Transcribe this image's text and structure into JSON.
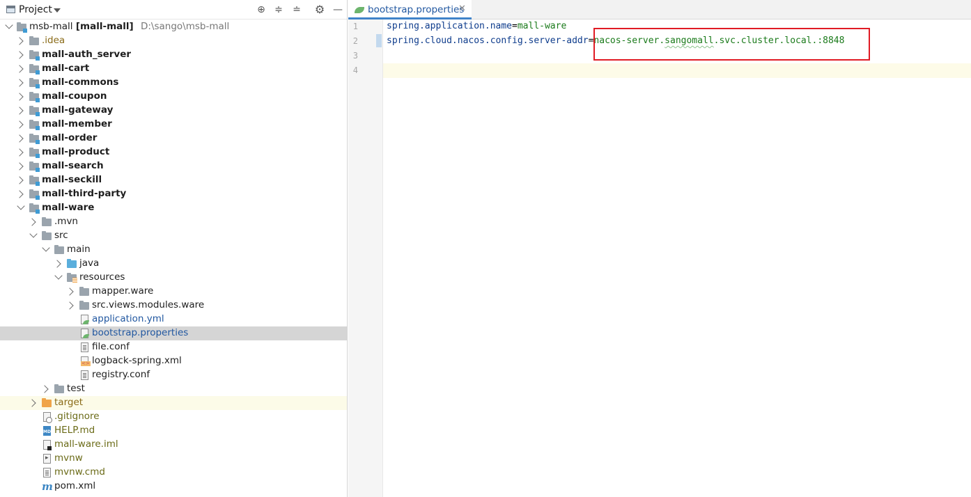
{
  "project_pane": {
    "title": "Project",
    "tree": {
      "root": {
        "name": "msb-mall",
        "module": "[mall-mall]",
        "path": "D:\\sango\\msb-mall"
      },
      "idea": ".idea",
      "modules": [
        "mall-auth_server",
        "mall-cart",
        "mall-commons",
        "mall-coupon",
        "mall-gateway",
        "mall-member",
        "mall-order",
        "mall-product",
        "mall-search",
        "mall-seckill",
        "mall-third-party",
        "mall-ware"
      ],
      "ware": {
        "mvn": ".mvn",
        "src": "src",
        "main": "main",
        "java": "java",
        "resources": "resources",
        "mapper": "mapper.ware",
        "views": "src.views.modules.ware",
        "files": [
          "application.yml",
          "bootstrap.properties",
          "file.conf",
          "logback-spring.xml",
          "registry.conf"
        ],
        "test": "test",
        "target": "target",
        "root_files": [
          ".gitignore",
          "HELP.md",
          "mall-ware.iml",
          "mvnw",
          "mvnw.cmd",
          "pom.xml"
        ]
      }
    }
  },
  "editor": {
    "tab_label": "bootstrap.properties",
    "line_numbers": [
      "1",
      "2",
      "3",
      "4"
    ],
    "lines": [
      {
        "key": "spring.application.name",
        "eq": "=",
        "value": "mall-ware"
      },
      {
        "key": "spring.cloud.nacos.config.server-addr",
        "eq": "=",
        "value_a": "nacos-server.",
        "value_b": "sangomall",
        "value_c": ".svc.cluster.local.:8848"
      }
    ],
    "accent_colors": {
      "highlight_box": "#e01b24",
      "tab_underline": "#4083c9"
    }
  }
}
